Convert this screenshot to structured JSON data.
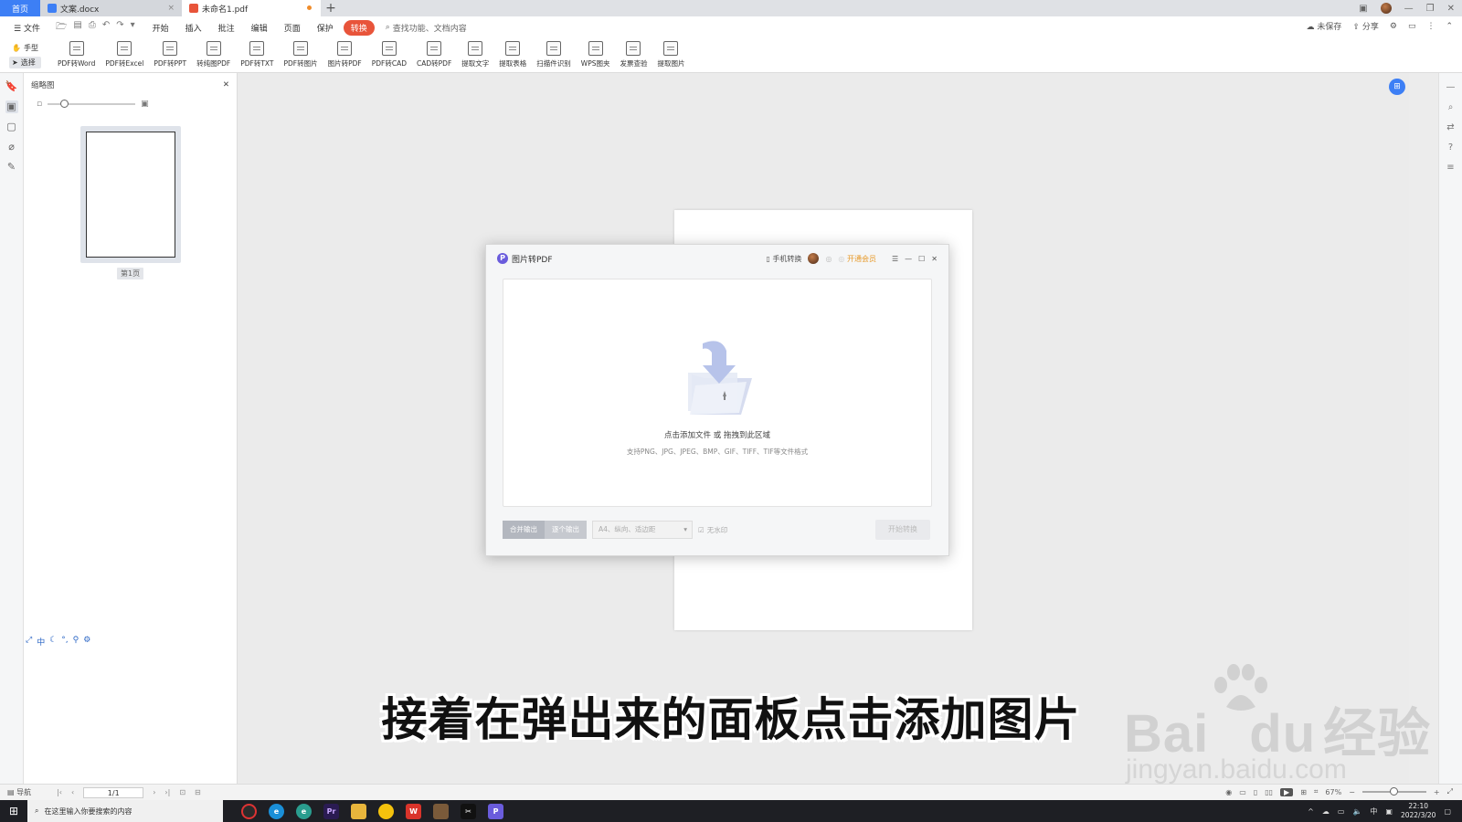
{
  "titlebar": {
    "tabs": [
      {
        "label": "首页"
      },
      {
        "label": "文案.docx"
      },
      {
        "label": "未命名1.pdf"
      }
    ],
    "new_tab": "+"
  },
  "menubar": {
    "file": "文件",
    "items": [
      "开始",
      "插入",
      "批注",
      "编辑",
      "页面",
      "保护",
      "转换"
    ],
    "search": "查找功能、文档内容",
    "right": {
      "unsaved": "未保存",
      "share": "分享"
    }
  },
  "ribbon": {
    "hand": "手型",
    "select": "选择",
    "buttons": [
      "PDF转Word",
      "PDF转Excel",
      "PDF转PPT",
      "转纯图PDF",
      "PDF转TXT",
      "PDF转图片",
      "图片转PDF",
      "PDF转CAD",
      "CAD转PDF",
      "提取文字",
      "提取表格",
      "扫描件识别",
      "WPS图夹",
      "发票查验",
      "提取图片"
    ]
  },
  "thumbnail_panel": {
    "title": "缩略图",
    "page_label": "第1页"
  },
  "dialog": {
    "title": "图片转PDF",
    "phone_convert": "手机转换",
    "vip": "开通会员",
    "drop_main": "点击添加文件 或 拖拽到此区域",
    "drop_sub": "支持PNG、JPG、JPEG、BMP、GIF、TIFF、TIF等文件格式",
    "merge_output": "合并输出",
    "separate_output": "逐个输出",
    "page_setting": "A4、纵向、适边距",
    "no_margin": "无水印",
    "start_button": "开始转换"
  },
  "statusbar": {
    "nav": "导航",
    "page": "1/1",
    "zoom": "67%"
  },
  "taskbar": {
    "search_placeholder": "在这里输入你要搜索的内容",
    "ime": "中",
    "time": "22:10",
    "date": "2022/3/20"
  },
  "subtitle": "接着在弹出来的面板点击添加图片",
  "watermark": {
    "logo": "Bai",
    "logo2": "du",
    "cn": "经验",
    "url": "jingyan.baidu.com"
  },
  "colors": {
    "accent": "#3d7ff5",
    "convert_tab": "#e8543a",
    "vip": "#e79a2a",
    "dialog_logo": "#6a5cdc"
  }
}
